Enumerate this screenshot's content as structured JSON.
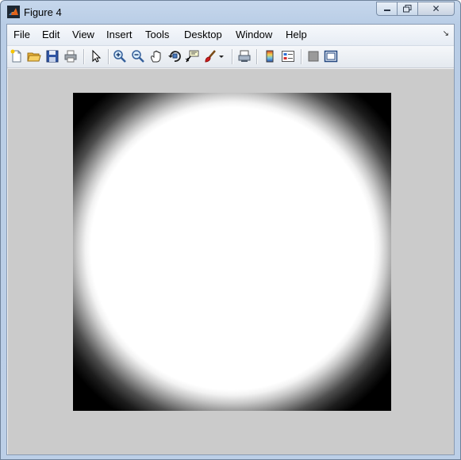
{
  "window": {
    "title": "Figure 4",
    "close_glyph": "✕",
    "minimize_icon": "minimize-icon",
    "maximize_icon": "maximize-icon"
  },
  "menubar": {
    "items": [
      {
        "label": "File"
      },
      {
        "label": "Edit"
      },
      {
        "label": "View"
      },
      {
        "label": "Insert"
      },
      {
        "label": "Tools"
      },
      {
        "label": "Desktop"
      },
      {
        "label": "Window"
      },
      {
        "label": "Help"
      }
    ],
    "overflow_glyph": "↘"
  },
  "toolbar": {
    "buttons": [
      {
        "icon": "new-figure-icon"
      },
      {
        "icon": "open-file-icon"
      },
      {
        "icon": "save-figure-icon"
      },
      {
        "icon": "print-figure-icon"
      },
      {
        "icon": "edit-plot-arrow-icon"
      },
      {
        "icon": "zoom-in-icon"
      },
      {
        "icon": "zoom-out-icon"
      },
      {
        "icon": "pan-hand-icon"
      },
      {
        "icon": "rotate-3d-icon"
      },
      {
        "icon": "data-cursor-icon"
      },
      {
        "icon": "brush-icon"
      },
      {
        "icon": "link-plot-icon"
      },
      {
        "icon": "insert-colorbar-icon"
      },
      {
        "icon": "insert-legend-icon"
      },
      {
        "icon": "hide-plot-tools-icon"
      },
      {
        "icon": "show-plot-tools-icon"
      }
    ]
  },
  "figure": {
    "image": "radial-gradient-disk",
    "colors": {
      "background": "#cbcbcb",
      "disk": "#ffffff",
      "corners": "#000000"
    }
  }
}
